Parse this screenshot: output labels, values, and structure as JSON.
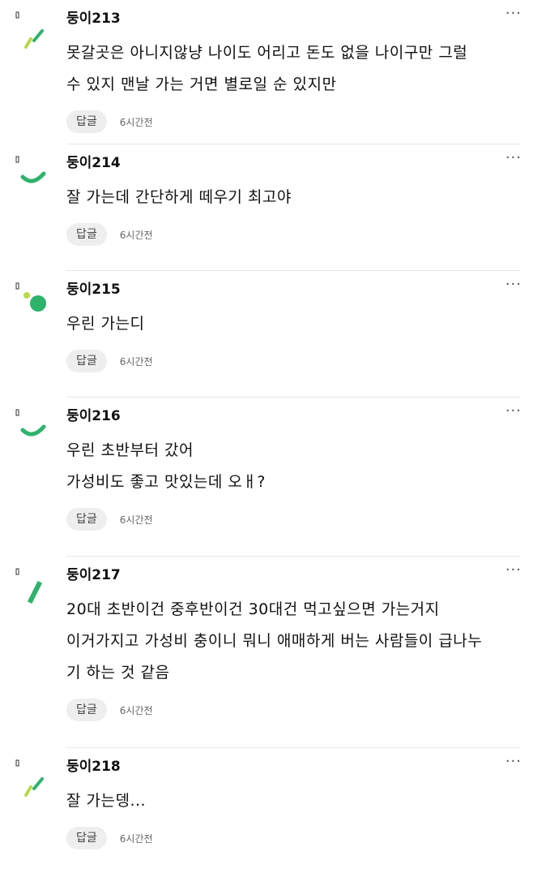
{
  "comments": [
    {
      "nickname": "둥이213",
      "lines": [
        "못갈곳은 아니지않냥 나이도 어리고 돈도 없을 나이구만 그럴",
        "수 있지 맨날 가는 거면 별로일 순 있지만"
      ],
      "reply_label": "답글",
      "time": "6시간전",
      "more": "···",
      "avatar_icon": "leaf-avatar-icon"
    },
    {
      "nickname": "둥이214",
      "lines": [
        "잘 가는데 간단하게 떼우기 최고야"
      ],
      "reply_label": "답글",
      "time": "6시간전",
      "more": "···",
      "avatar_icon": "smile-avatar-icon"
    },
    {
      "nickname": "둥이215",
      "lines": [
        "우린 가는디"
      ],
      "reply_label": "답글",
      "time": "6시간전",
      "more": "···",
      "avatar_icon": "dot-avatar-icon"
    },
    {
      "nickname": "둥이216",
      "lines": [
        "우린 초반부터 갔어",
        "가성비도 좋고 맛있는데 오ㅐ?"
      ],
      "reply_label": "답글",
      "time": "6시간전",
      "more": "···",
      "avatar_icon": "smile-avatar-icon"
    },
    {
      "nickname": "둥이217",
      "lines": [
        "20대 초반이건 중후반이건 30대건 먹고싶으면 가는거지",
        "이거가지고 가성비 충이니 뭐니 애매하게 버는 사람들이 급나누",
        "기 하는 것 같음"
      ],
      "reply_label": "답글",
      "time": "6시간전",
      "more": "···",
      "avatar_icon": "stroke-avatar-icon"
    },
    {
      "nickname": "둥이218",
      "lines": [
        "잘 가는뎅..."
      ],
      "reply_label": "답글",
      "time": "6시간전",
      "more": "···",
      "avatar_icon": "leaf-avatar-icon"
    }
  ],
  "colors": {
    "green": "#2db36b",
    "light_green": "#b8d94a",
    "text": "#111111",
    "time": "#666666",
    "reply_bg": "#eeeeee",
    "divider": "#e8e8e8"
  }
}
